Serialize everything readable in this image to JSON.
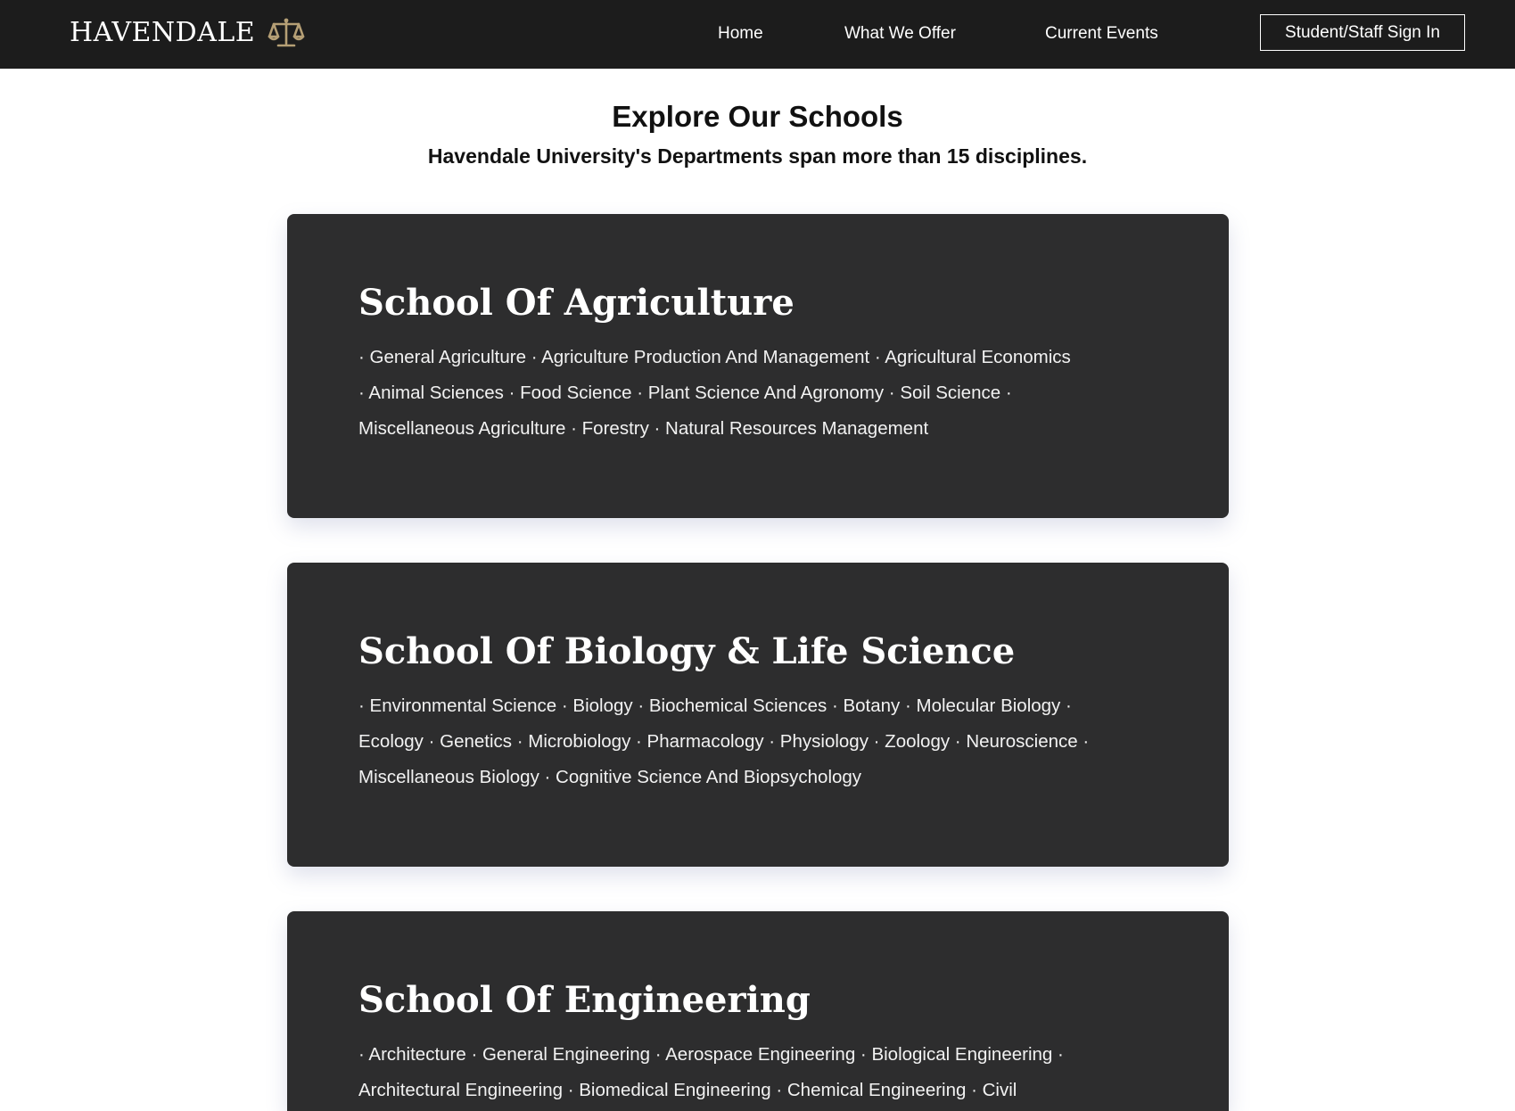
{
  "header": {
    "brand": "HAVENDALE",
    "brand_icon": "scales-icon",
    "brand_icon_color": "#b59f75",
    "nav": [
      {
        "label": "Home"
      },
      {
        "label": "What We Offer"
      },
      {
        "label": "Current Events"
      }
    ],
    "signin_label": "Student/Staff Sign In"
  },
  "hero": {
    "title": "Explore Our Schools",
    "subtitle": "Havendale University's Departments span more than 15 disciplines."
  },
  "schools": [
    {
      "title": "School Of Agriculture",
      "lines": [
        "· General Agriculture · Agriculture Production And Management · Agricultural Economics",
        "· Animal Sciences · Food Science · Plant Science And Agronomy · Soil Science ·",
        "Miscellaneous Agriculture · Forestry · Natural Resources Management"
      ]
    },
    {
      "title": "School Of Biology & Life Science",
      "lines": [
        "· Environmental Science · Biology · Biochemical Sciences · Botany · Molecular Biology ·",
        "Ecology · Genetics · Microbiology · Pharmacology · Physiology · Zoology · Neuroscience ·",
        "Miscellaneous Biology · Cognitive Science And Biopsychology"
      ]
    },
    {
      "title": "School Of Engineering",
      "lines": [
        "· Architecture · General Engineering · Aerospace Engineering · Biological Engineering ·",
        "Architectural Engineering · Biomedical Engineering · Chemical Engineering · Civil"
      ]
    }
  ],
  "colors": {
    "topbar": "#1c1c1c",
    "card": "#2d2d2e",
    "accent": "#b59f75"
  }
}
